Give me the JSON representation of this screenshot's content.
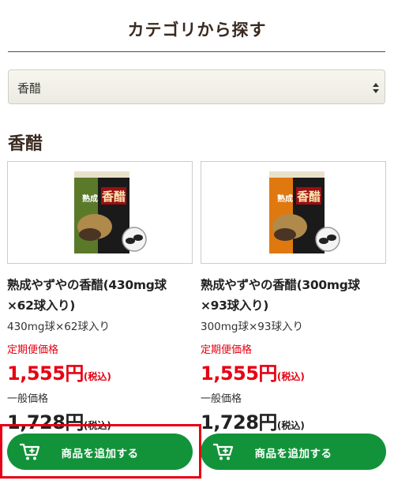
{
  "header": {
    "title": "カテゴリから探す"
  },
  "category_select": {
    "selected": "香醋",
    "icon": "select-updown-arrows"
  },
  "section": {
    "title": "香醋"
  },
  "products": [
    {
      "name": "熟成やずやの香醋(430mg球×62球入り)",
      "spec": "430mg球×62球入り",
      "subscription_label": "定期便価格",
      "subscription_price": "1,555円",
      "subscription_tax": "(税込)",
      "regular_label": "一般価格",
      "regular_price": "1,728円",
      "regular_tax": "(税込)",
      "add_button": "商品を追加する",
      "package_color": "#5a7a2a",
      "package_label_big": "香醋",
      "package_label_small": "熟成"
    },
    {
      "name": "熟成やずやの香醋(300mg球×93球入り)",
      "spec": "300mg球×93球入り",
      "subscription_label": "定期便価格",
      "subscription_price": "1,555円",
      "subscription_tax": "(税込)",
      "regular_label": "一般価格",
      "regular_price": "1,728円",
      "regular_tax": "(税込)",
      "add_button": "商品を追加する",
      "package_color": "#e07810",
      "package_label_big": "香醋",
      "package_label_small": "熟成"
    }
  ],
  "colors": {
    "accent_green": "#12933a",
    "price_red": "#e60012",
    "highlight": "#e60012"
  }
}
